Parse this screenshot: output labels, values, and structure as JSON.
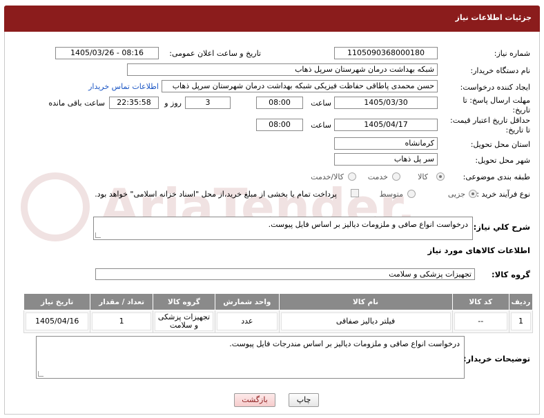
{
  "header": {
    "title": "جزئیات اطلاعات نیاز"
  },
  "form": {
    "need_number_label": "شماره نیاز:",
    "need_number": "1105090368000180",
    "announce_label": "تاریخ و ساعت اعلان عمومی:",
    "announce_value": "1405/03/26 - 08:16",
    "buyer_org_label": "نام دستگاه خریدار:",
    "buyer_org": "شبکه بهداشت درمان شهرستان سرپل ذهاب",
    "requester_label": "ایجاد کننده درخواست:",
    "requester": "حسن محمدی پاطاقی حفاظت فیزیکی شبکه بهداشت درمان شهرستان سرپل ذهاب",
    "contact_link": "اطلاعات تماس خریدار",
    "deadline_label_1": "مهلت ارسال پاسخ: تا",
    "deadline_label_2": "تاریخ:",
    "deadline_date": "1405/03/30",
    "time_label": "ساعت",
    "deadline_time": "08:00",
    "days_value": "3",
    "days_label": "روز و",
    "remaining_value": "22:35:58",
    "remaining_label": "ساعت باقی مانده",
    "validity_label_1": "حداقل تاریخ اعتبار قیمت:",
    "validity_label_2": "تا تاریخ:",
    "validity_date": "1405/04/17",
    "validity_time": "08:00",
    "province_label": "استان محل تحویل:",
    "province": "کرمانشاه",
    "city_label": "شهر محل تحویل:",
    "city": "سر پل ذهاب",
    "category_label": "طبقه بندی موضوعی:",
    "category_options": [
      "کالا",
      "خدمت",
      "کالا/خدمت"
    ],
    "category_selected": "کالا",
    "process_label": "نوع فرآیند خرید :",
    "process_options": [
      "جزیی",
      "متوسط"
    ],
    "process_selected": "جزیی",
    "payment_note": "پرداخت تمام یا بخشی از مبلغ خرید،از محل \"اسناد خزانه اسلامی\" خواهد بود."
  },
  "summary": {
    "label": "شرح کلي نياز:",
    "text": "درخواست انواع صافی و ملزومات دیالیز بر  اساس فایل پیوست."
  },
  "goods_section_title": "اطلاعات کالاهای مورد نیاز",
  "goods_group": {
    "label": "گروه کالا:",
    "value": "تجهیزات پزشکی و سلامت"
  },
  "table": {
    "headers": [
      "ردیف",
      "کد کالا",
      "نام کالا",
      "واحد شمارش",
      "گروه کالا",
      "تعداد / مقدار",
      "تاریخ نیاز"
    ],
    "rows": [
      [
        "1",
        "--",
        "فیلتر دیالیز صفاقی",
        "عدد",
        "تجهیزات پزشکی و سلامت",
        "1",
        "1405/04/16"
      ]
    ]
  },
  "buyer_notes": {
    "label": "توضیحات خریدار:",
    "text": "درخواست انواع صافی و ملزومات دیالیز بر  اساس مندرجات فایل پیوست."
  },
  "buttons": {
    "print": "چاپ",
    "back": "بازگشت"
  },
  "watermark": {
    "text": "AriaTender.net"
  }
}
